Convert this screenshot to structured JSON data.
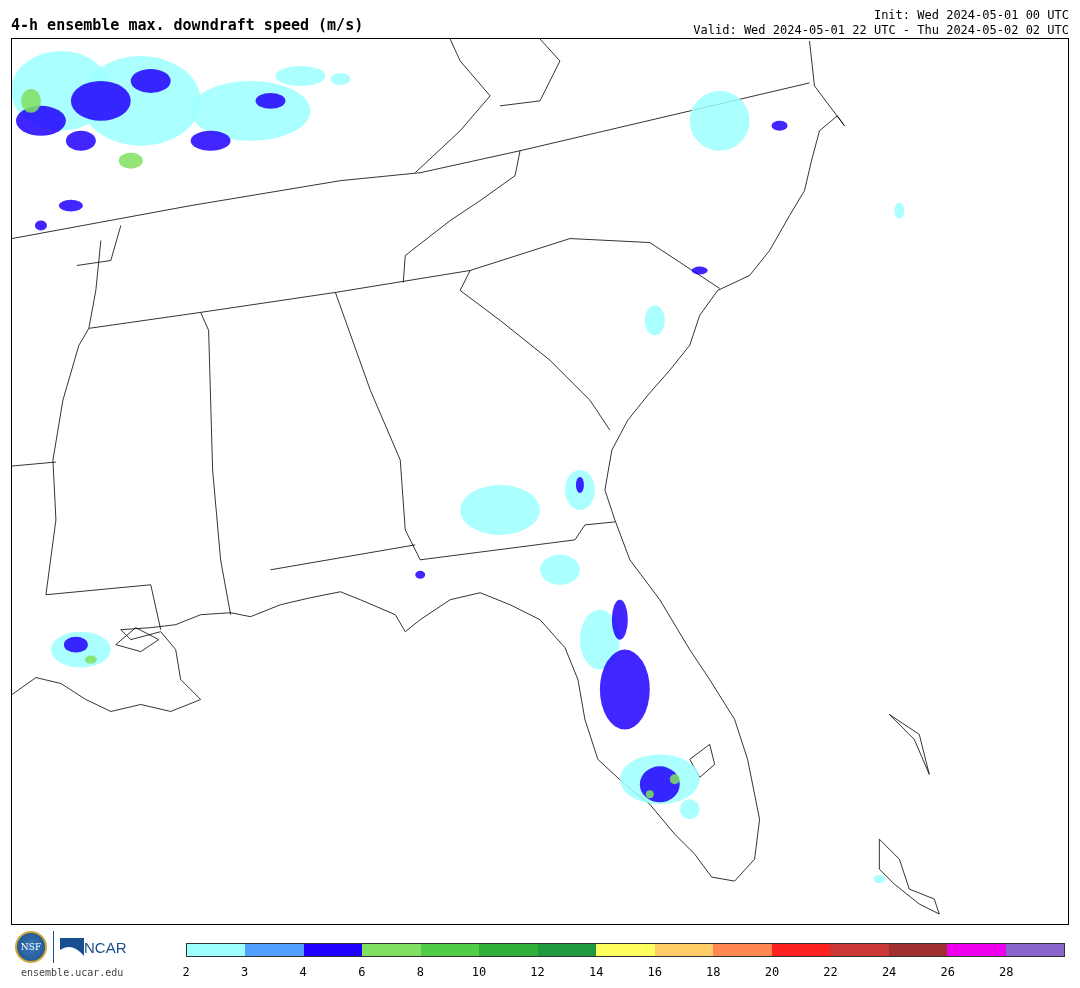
{
  "title": "4-h ensemble max. downdraft speed (m/s)",
  "init": "Init: Wed 2024-05-01 00 UTC",
  "valid": "Valid: Wed 2024-05-01 22 UTC - Thu 2024-05-02 02 UTC",
  "logo": {
    "nsf": "NSF",
    "ncar": "NCAR",
    "url": "ensemble.ucar.edu"
  },
  "colorbar": [
    {
      "color": "#9effff",
      "label": "2"
    },
    {
      "color": "#52a0ff",
      "label": "3"
    },
    {
      "color": "#2000ff",
      "label": "4"
    },
    {
      "color": "#80e060",
      "label": "6"
    },
    {
      "color": "#50cc48",
      "label": "8"
    },
    {
      "color": "#30b038",
      "label": "10"
    },
    {
      "color": "#209840",
      "label": "12"
    },
    {
      "color": "#ffff60",
      "label": "14"
    },
    {
      "color": "#ffcc66",
      "label": "16"
    },
    {
      "color": "#ff8850",
      "label": "18"
    },
    {
      "color": "#ff2020",
      "label": "20"
    },
    {
      "color": "#cc3838",
      "label": "22"
    },
    {
      "color": "#a03030",
      "label": "24"
    },
    {
      "color": "#ee00ee",
      "label": "26"
    },
    {
      "color": "#8866cc",
      "label": "28"
    }
  ]
}
